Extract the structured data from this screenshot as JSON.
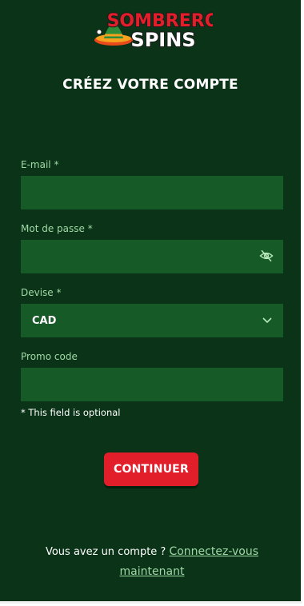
{
  "brand": {
    "line1": "SOMBRERO",
    "line2": "SPINS"
  },
  "heading": "CRÉEZ VOTRE COMPTE",
  "form": {
    "email_label": "E-mail *",
    "email_value": "",
    "password_label": "Mot de passe *",
    "password_value": "",
    "currency_label": "Devise *",
    "currency_value": "CAD",
    "promo_label": "Promo code",
    "promo_value": "",
    "optional_note": "* This field is optional"
  },
  "continue_label": "CONTINUER",
  "footer": {
    "question": "Vous avez un compte ?",
    "link": "Connectez-vous maintenant"
  },
  "colors": {
    "background": "#0b3317",
    "field": "#155a27",
    "label": "#9fd9a6",
    "button": "#e31e2b"
  }
}
